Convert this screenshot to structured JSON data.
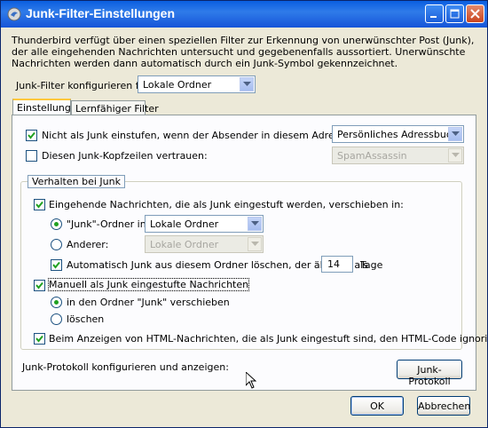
{
  "window": {
    "title": "Junk-Filter-Einstellungen",
    "controls": [
      "minimize-icon",
      "maximize-icon",
      "close-icon"
    ]
  },
  "intro_text": "Thunderbird verfügt über einen speziellen Filter zur Erkennung von unerwünschter Post (Junk), der alle eingehenden Nachrichten untersucht und gegebenenfalls aussortiert. Unerwünschte Nachrichten werden dann automatisch durch ein Junk-Symbol gekennzeichnet.",
  "configure_for": {
    "label": "Junk-Filter konfigurieren für:",
    "value": "Lokale Ordner"
  },
  "tabs": [
    {
      "label": "Einstellungen",
      "active": true
    },
    {
      "label": "Lernfähiger Filter",
      "active": false
    }
  ],
  "settings": {
    "not_junk_addressbook": {
      "label": "Nicht als Junk einstufen, wenn der Absender in diesem Adressbuch ist:",
      "checked": true,
      "select_value": "Persönliches Adressbuch"
    },
    "trust_headers": {
      "label": "Diesen Junk-Kopfzeilen vertrauen:",
      "checked": false,
      "select_value": "SpamAssassin"
    },
    "behavior_legend": "Verhalten bei Junk",
    "move_incoming": {
      "label": "Eingehende Nachrichten, die als Junk eingestuft werden, verschieben in:",
      "checked": true
    },
    "junk_folder_radio": {
      "label": "\"Junk\"-Ordner in:",
      "selected": true,
      "select_value": "Lokale Ordner"
    },
    "other_radio": {
      "label": "Anderer:",
      "selected": false,
      "select_value": "Lokale Ordner"
    },
    "auto_delete": {
      "label": "Automatisch Junk aus diesem Ordner löschen, der älter ist als",
      "checked": true,
      "days": "14",
      "unit": "Tage"
    },
    "manual_junk": {
      "label": "Manuell als Junk eingestufte Nachrichten",
      "checked": true
    },
    "move_to_junk_radio": {
      "label": "in den Ordner \"Junk\" verschieben",
      "selected": true
    },
    "delete_radio": {
      "label": "löschen",
      "selected": false
    },
    "ignore_html": {
      "label": "Beim Anzeigen von HTML-Nachrichten, die als Junk eingestuft sind, den HTML-Code ignorieren",
      "checked": true
    },
    "junk_log_label": "Junk-Protokoll konfigurieren und anzeigen:",
    "junk_log_button": "Junk-Protokoll"
  },
  "buttons": {
    "ok": "OK",
    "cancel": "Abbrechen"
  },
  "colors": {
    "titlebar": "#0a5ee0",
    "dialog_bg": "#ece9d8",
    "active_tab_highlight": "#ffc83c",
    "check_green": "#21a121"
  }
}
